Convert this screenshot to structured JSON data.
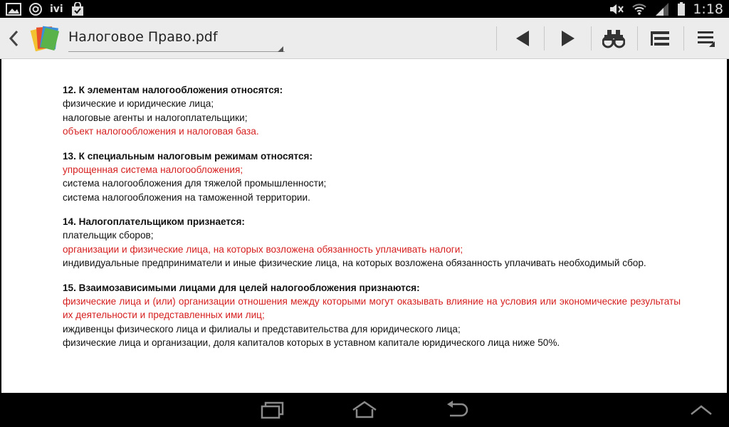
{
  "statusbar": {
    "left_icons": [
      "gallery-icon",
      "at-icon",
      "shopping-bag-icon"
    ],
    "ivi_label": "ivi",
    "right_icons": [
      "mute-icon",
      "wifi-icon",
      "signal-icon",
      "battery-icon"
    ],
    "time": "1:18"
  },
  "actionbar": {
    "document_title": "Налоговое Право.pdf",
    "buttons": [
      "previous-icon",
      "next-icon",
      "find-icon",
      "outline-icon",
      "menu-icon"
    ]
  },
  "document": {
    "questions": [
      {
        "title": "12. К элементам налогообложения относятся:",
        "answers": [
          {
            "text": "физические и юридические лица;",
            "correct": false
          },
          {
            "text": "налоговые агенты и налогоплательщики;",
            "correct": false
          },
          {
            "text": "объект налогообложения и налоговая база.",
            "correct": true
          }
        ]
      },
      {
        "title": "13. К специальным налоговым режимам относятся:",
        "answers": [
          {
            "text": "упрощенная система налогообложения;",
            "correct": true
          },
          {
            "text": "система налогообложения для тяжелой промышленности;",
            "correct": false
          },
          {
            "text": "система налогообложения на таможенной территории.",
            "correct": false
          }
        ]
      },
      {
        "title": "14. Налогоплательщиком признается:",
        "answers": [
          {
            "text": "плательщик сборов;",
            "correct": false
          },
          {
            "text": "организации и физические лица, на которых возложена обязанность уплачивать налоги;",
            "correct": true
          },
          {
            "text": "индивидуальные предприниматели и иные физические лица, на которых возложена обязанность уплачивать необходимый сбор.",
            "correct": false
          }
        ]
      },
      {
        "title": "15. Взаимозависимыми лицами для целей налогообложения признаются:",
        "answers": [
          {
            "text": "физические лица и (или) организации отношения между которыми могут оказывать влияние на условия или экономические результаты их деятельности и представленных ими лиц;",
            "correct": true
          },
          {
            "text": "иждивенцы физического лица и филиалы и представительства для юридического лица;",
            "correct": false
          },
          {
            "text": "физические лица и организации, доля капиталов которых в уставном капитале юридического лица ниже 50%.",
            "correct": false
          }
        ]
      }
    ]
  },
  "colors": {
    "correct_answer": "#d61f1f",
    "text": "#111111",
    "actionbar_bg": "#ececec"
  },
  "navbar": {
    "buttons": [
      "recent-apps-icon",
      "home-icon",
      "back-icon",
      "hide-keyboard-icon"
    ]
  }
}
